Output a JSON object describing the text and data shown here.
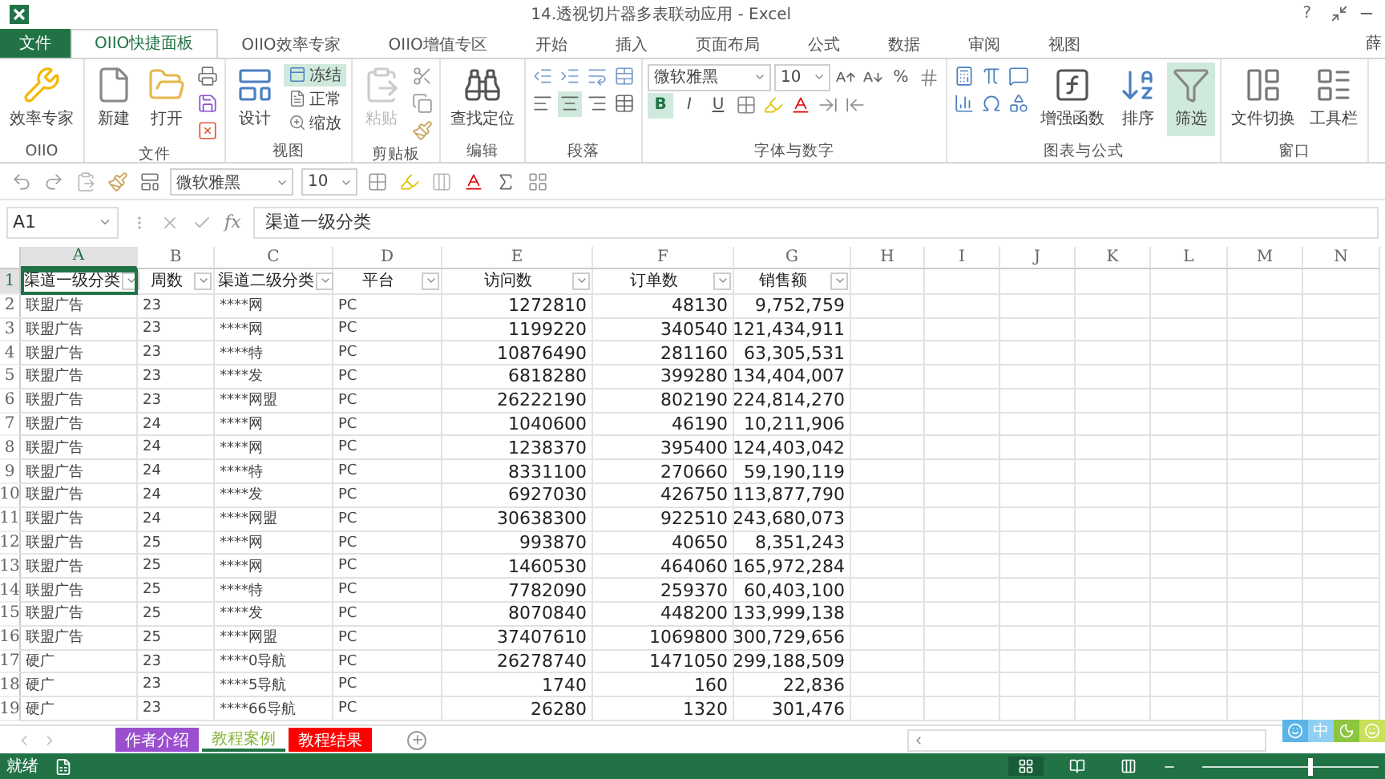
{
  "window": {
    "title": "14.透视切片器多表联动应用 - Excel",
    "help": "?",
    "user": "薛"
  },
  "menu_tabs": [
    {
      "kind": "file",
      "label": "文件",
      "selected": false
    },
    {
      "kind": "tab",
      "label": "OIIO快捷面板",
      "selected": true
    },
    {
      "kind": "tab",
      "label": "OIIO效率专家",
      "selected": false
    },
    {
      "kind": "tab",
      "label": "OIIO增值专区",
      "selected": false
    },
    {
      "kind": "tab",
      "label": "开始",
      "selected": false
    },
    {
      "kind": "tab",
      "label": "插入",
      "selected": false
    },
    {
      "kind": "tab",
      "label": "页面布局",
      "selected": false
    },
    {
      "kind": "tab",
      "label": "公式",
      "selected": false
    },
    {
      "kind": "tab",
      "label": "数据",
      "selected": false
    },
    {
      "kind": "tab",
      "label": "审阅",
      "selected": false
    },
    {
      "kind": "tab",
      "label": "视图",
      "selected": false
    }
  ],
  "ribbon": [
    {
      "label": "OIIO",
      "parts": [
        {
          "kind": "large",
          "label": "效率专家"
        }
      ]
    },
    {
      "label": "文件",
      "parts": [
        {
          "kind": "large",
          "label": "新建"
        },
        {
          "kind": "large",
          "label": "打开"
        },
        {
          "kind": "stack",
          "lines": [
            [
              {
                "kind": "icon"
              }
            ],
            [
              {
                "kind": "icon"
              }
            ],
            [
              {
                "kind": "icon"
              }
            ]
          ]
        }
      ]
    },
    {
      "label": "视图",
      "parts": [
        {
          "kind": "large",
          "label": "设计"
        },
        {
          "kind": "stack",
          "lines": [
            [
              {
                "kind": "small",
                "label": "冻结",
                "selected": true
              }
            ],
            [
              {
                "kind": "small",
                "label": "正常",
                "selected": false
              }
            ],
            [
              {
                "kind": "small",
                "label": "缩放",
                "selected": false
              }
            ]
          ]
        }
      ]
    },
    {
      "label": "剪贴板",
      "parts": [
        {
          "kind": "large",
          "label": "粘贴",
          "disabled": true
        },
        {
          "kind": "stack",
          "lines": [
            [
              {
                "kind": "icon"
              }
            ],
            [
              {
                "kind": "icon"
              }
            ],
            [
              {
                "kind": "icon"
              }
            ]
          ]
        }
      ]
    },
    {
      "label": "编辑",
      "parts": [
        {
          "kind": "large",
          "label": "查找定位"
        }
      ]
    },
    {
      "label": "段落",
      "parts": [
        {
          "kind": "stack",
          "lines": [
            [
              {
                "kind": "icon"
              },
              {
                "kind": "icon"
              },
              {
                "kind": "icon"
              },
              {
                "kind": "icon"
              }
            ],
            [
              {
                "kind": "icon",
                "selected": false
              },
              {
                "kind": "icon",
                "selected": true
              },
              {
                "kind": "icon",
                "selected": false
              },
              {
                "kind": "icon"
              }
            ]
          ]
        }
      ]
    },
    {
      "label": "字体与数字",
      "parts": [
        {
          "kind": "stack",
          "lines": [
            [
              {
                "kind": "field",
                "value": "微软雅黑"
              },
              {
                "kind": "field",
                "value": "10"
              },
              {
                "kind": "icon"
              },
              {
                "kind": "icon"
              },
              {
                "kind": "text",
                "label": "%"
              },
              {
                "kind": "icon"
              }
            ],
            [
              {
                "kind": "text",
                "label": "B",
                "selected": true
              },
              {
                "kind": "text",
                "label": "I",
                "selected": false
              },
              {
                "kind": "text",
                "label": "U",
                "selected": false
              },
              {
                "kind": "icon"
              },
              {
                "kind": "icon"
              },
              {
                "kind": "icon"
              },
              {
                "kind": "icon"
              },
              {
                "kind": "icon"
              }
            ]
          ]
        }
      ]
    },
    {
      "label": "图表与公式",
      "parts": [
        {
          "kind": "stack",
          "lines": [
            [
              {
                "kind": "icon"
              },
              {
                "kind": "icon"
              },
              {
                "kind": "icon"
              }
            ],
            [
              {
                "kind": "icon"
              },
              {
                "kind": "icon"
              },
              {
                "kind": "icon"
              }
            ]
          ]
        },
        {
          "kind": "large",
          "label": "增强函数",
          "selected": false
        },
        {
          "kind": "large",
          "label": "排序",
          "selected": false
        },
        {
          "kind": "large",
          "label": "筛选",
          "selected": true
        }
      ]
    },
    {
      "label": "窗口",
      "parts": [
        {
          "kind": "large",
          "label": "文件切换"
        },
        {
          "kind": "large",
          "label": "工具栏"
        }
      ]
    }
  ],
  "quick_toolbar": [
    {
      "kind": "icon"
    },
    {
      "kind": "icon"
    },
    {
      "kind": "icon"
    },
    {
      "kind": "icon"
    },
    {
      "kind": "icon"
    },
    {
      "kind": "field",
      "value": "微软雅黑"
    },
    {
      "kind": "field",
      "value": "10"
    },
    {
      "kind": "icon"
    },
    {
      "kind": "icon"
    },
    {
      "kind": "icon"
    },
    {
      "kind": "icon"
    },
    {
      "kind": "icon"
    },
    {
      "kind": "icon"
    }
  ],
  "formula_bar": {
    "name_box": "A1",
    "fx": "fx",
    "formula": "渠道一级分类"
  },
  "sheet": {
    "columns": [
      "A",
      "B",
      "C",
      "D",
      "E",
      "F",
      "G",
      "H",
      "I",
      "J",
      "K",
      "L",
      "M",
      "N"
    ],
    "header": {
      "number": "1",
      "cells": [
        {
          "text": "渠道一级分类",
          "selected": true
        },
        {
          "text": "周数",
          "selected": false
        },
        {
          "text": "渠道二级分类",
          "selected": false
        },
        {
          "text": "平台",
          "selected": false
        },
        {
          "text": "访问数",
          "selected": false
        },
        {
          "text": "订单数",
          "selected": false
        },
        {
          "text": "销售额",
          "selected": false
        }
      ]
    },
    "row_numbers": [
      "2",
      "3",
      "4",
      "5",
      "6",
      "7",
      "8",
      "9",
      "10",
      "11",
      "12",
      "13",
      "14",
      "15",
      "16",
      "17",
      "18",
      "19"
    ],
    "rows": [
      [
        "联盟广告",
        "23",
        "****网",
        "PC",
        "1272810",
        "48130",
        "9,752,759"
      ],
      [
        "联盟广告",
        "23",
        "****网",
        "PC",
        "1199220",
        "340540",
        "121,434,911"
      ],
      [
        "联盟广告",
        "23",
        "****特",
        "PC",
        "10876490",
        "281160",
        "63,305,531"
      ],
      [
        "联盟广告",
        "23",
        "****发",
        "PC",
        "6818280",
        "399280",
        "134,404,007"
      ],
      [
        "联盟广告",
        "23",
        "****网盟",
        "PC",
        "26222190",
        "802190",
        "224,814,270"
      ],
      [
        "联盟广告",
        "24",
        "****网",
        "PC",
        "1040600",
        "46190",
        "10,211,906"
      ],
      [
        "联盟广告",
        "24",
        "****网",
        "PC",
        "1238370",
        "395400",
        "124,403,042"
      ],
      [
        "联盟广告",
        "24",
        "****特",
        "PC",
        "8331100",
        "270660",
        "59,190,119"
      ],
      [
        "联盟广告",
        "24",
        "****发",
        "PC",
        "6927030",
        "426750",
        "113,877,790"
      ],
      [
        "联盟广告",
        "24",
        "****网盟",
        "PC",
        "30638300",
        "922510",
        "243,680,073"
      ],
      [
        "联盟广告",
        "25",
        "****网",
        "PC",
        "993870",
        "40650",
        "8,351,243"
      ],
      [
        "联盟广告",
        "25",
        "****网",
        "PC",
        "1460530",
        "464060",
        "165,972,284"
      ],
      [
        "联盟广告",
        "25",
        "****特",
        "PC",
        "7782090",
        "259370",
        "60,403,100"
      ],
      [
        "联盟广告",
        "25",
        "****发",
        "PC",
        "8070840",
        "448200",
        "133,999,138"
      ],
      [
        "联盟广告",
        "25",
        "****网盟",
        "PC",
        "37407610",
        "1069800",
        "300,729,656"
      ],
      [
        "硬广",
        "23",
        "****0导航",
        "PC",
        "26278740",
        "1471050",
        "299,188,509"
      ],
      [
        "硬广",
        "23",
        "****5导航",
        "PC",
        "1740",
        "160",
        "22,836"
      ],
      [
        "硬广",
        "23",
        "****66导航",
        "PC",
        "26280",
        "1320",
        "301,476"
      ]
    ]
  },
  "sheet_tabs": [
    {
      "label": "作者介绍",
      "color": "#9b4fcf",
      "selected": false
    },
    {
      "label": "教程案例",
      "color": "#ffffff",
      "selected": true
    },
    {
      "label": "教程结果",
      "color": "#ff0000",
      "selected": false
    }
  ],
  "ime": {
    "label": "中"
  },
  "status_bar": {
    "status": "就绪",
    "zoom": {
      "level": 0.6
    }
  }
}
